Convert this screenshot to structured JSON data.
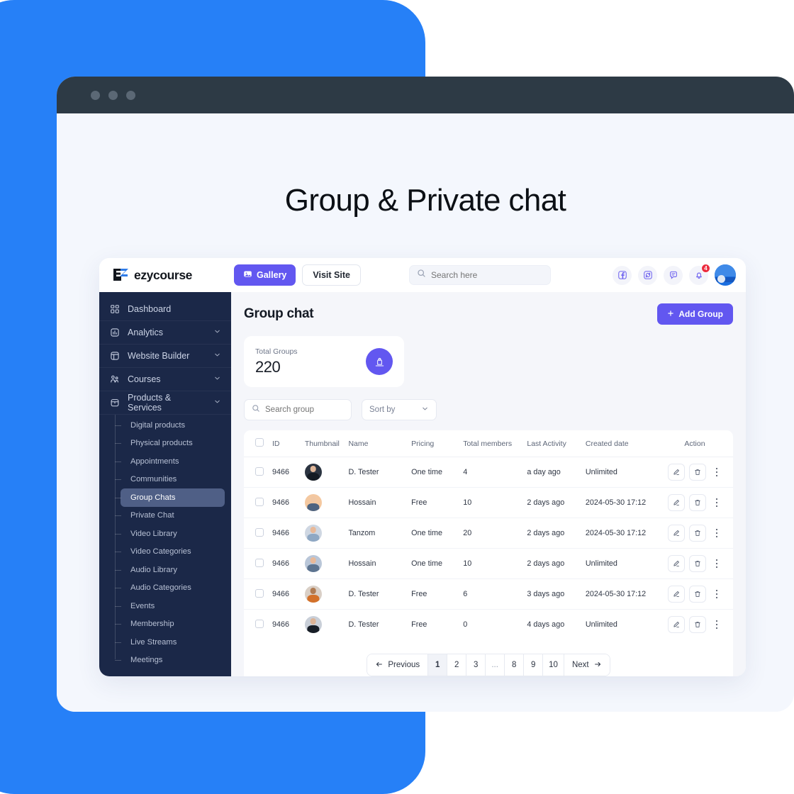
{
  "hero": {
    "title": "Group & Private chat"
  },
  "colors": {
    "accent": "#6257f0",
    "backdrop": "#2680f7",
    "sidebar": "#1b2848",
    "danger": "#ec2d3f"
  },
  "browser": {
    "dots": 3
  },
  "topbar": {
    "brand_name": "ezycourse",
    "gallery_label": "Gallery",
    "visit_site_label": "Visit Site",
    "search_placeholder": "Search here",
    "search_value": "",
    "notification_count": "4",
    "icons": [
      "facebook-icon",
      "sync-icon",
      "chat-icon",
      "bell-icon"
    ]
  },
  "sidebar": {
    "items": [
      {
        "label": "Dashboard",
        "icon": "grid-icon",
        "expandable": false
      },
      {
        "label": "Analytics",
        "icon": "chart-icon",
        "expandable": true
      },
      {
        "label": "Website Builder",
        "icon": "layout-icon",
        "expandable": true
      },
      {
        "label": "Courses",
        "icon": "people-icon",
        "expandable": true
      },
      {
        "label": "Products & Services",
        "icon": "box-icon",
        "expandable": true
      }
    ],
    "sub_items": [
      {
        "label": "Digital products",
        "active": false
      },
      {
        "label": "Physical products",
        "active": false
      },
      {
        "label": "Appointments",
        "active": false
      },
      {
        "label": "Communities",
        "active": false
      },
      {
        "label": "Group Chats",
        "active": true
      },
      {
        "label": "Private Chat",
        "active": false
      },
      {
        "label": "Video Library",
        "active": false
      },
      {
        "label": "Video Categories",
        "active": false
      },
      {
        "label": "Audio Library",
        "active": false
      },
      {
        "label": "Audio Categories",
        "active": false
      },
      {
        "label": "Events",
        "active": false
      },
      {
        "label": "Membership",
        "active": false
      },
      {
        "label": "Live Streams",
        "active": false
      },
      {
        "label": "Meetings",
        "active": false
      }
    ]
  },
  "main": {
    "page_title": "Group chat",
    "add_group_label": "Add Group",
    "stat": {
      "label": "Total Groups",
      "value": "220",
      "icon": "group-badge-icon"
    },
    "filters": {
      "search_placeholder": "Search group",
      "search_value": "",
      "sort_label": "Sort by"
    },
    "table": {
      "columns": [
        "ID",
        "Thumbnail",
        "Name",
        "Pricing",
        "Total members",
        "Last Activity",
        "Created date",
        "Action"
      ],
      "rows": [
        {
          "id": "9466",
          "name": "D. Tester",
          "pricing": "One time",
          "members": "4",
          "activity": "a day ago",
          "created": "Unlimited",
          "av_bg": "#2b3441",
          "av_skin": "#e0b79a",
          "av_body": "#141b24"
        },
        {
          "id": "9466",
          "name": "Hossain",
          "pricing": "Free",
          "members": "10",
          "activity": "2 days ago",
          "created": "2024-05-30 17:12",
          "av_bg": "#f4c8a0",
          "av_skin": "#f0c7a4",
          "av_body": "#4d6380"
        },
        {
          "id": "9466",
          "name": "Tanzom",
          "pricing": "One time",
          "members": "20",
          "activity": "2 days ago",
          "created": "2024-05-30 17:12",
          "av_bg": "#cfd7e2",
          "av_skin": "#e8b999",
          "av_body": "#8fa8c4"
        },
        {
          "id": "9466",
          "name": "Hossain",
          "pricing": "One time",
          "members": "10",
          "activity": "2 days ago",
          "created": "Unlimited",
          "av_bg": "#b9c6d8",
          "av_skin": "#e8b999",
          "av_body": "#5d7490"
        },
        {
          "id": "9466",
          "name": "D. Tester",
          "pricing": "Free",
          "members": "6",
          "activity": "3 days ago",
          "created": "2024-05-30 17:12",
          "av_bg": "#d9cfc6",
          "av_skin": "#b07b52",
          "av_body": "#d3712a"
        },
        {
          "id": "9466",
          "name": "D. Tester",
          "pricing": "Free",
          "members": "0",
          "activity": "4 days ago",
          "created": "Unlimited",
          "av_bg": "#c9cfd8",
          "av_skin": "#dcb396",
          "av_body": "#171d26"
        }
      ],
      "row_actions": [
        "edit-icon",
        "delete-icon",
        "more-icon"
      ]
    },
    "pagination": {
      "previous_label": "Previous",
      "next_label": "Next",
      "pages": [
        "1",
        "2",
        "3",
        "...",
        "8",
        "9",
        "10"
      ],
      "current": "1"
    }
  }
}
